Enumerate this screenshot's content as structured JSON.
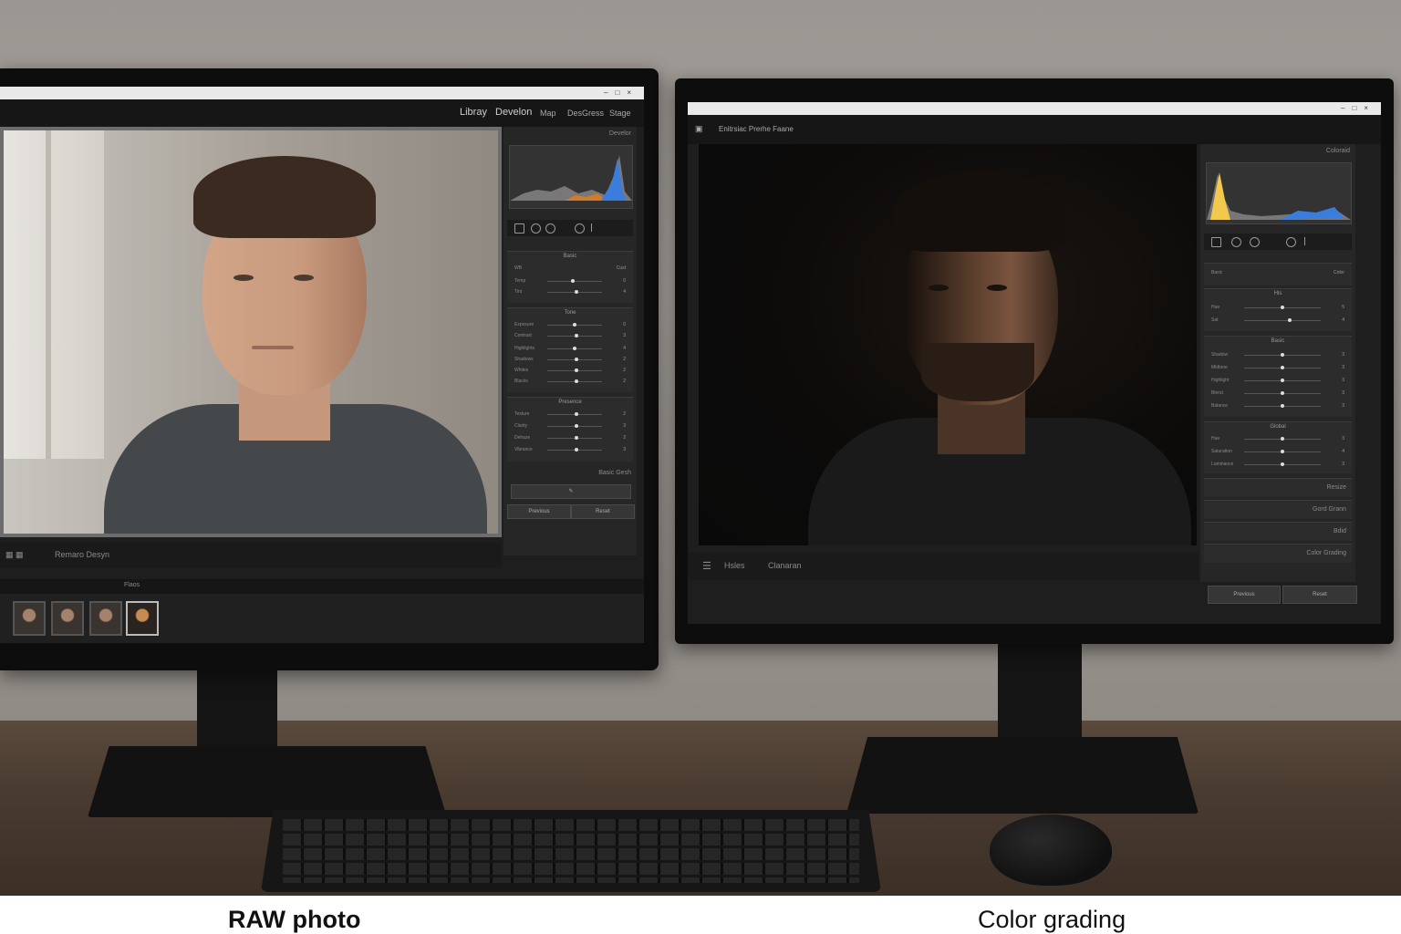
{
  "captions": {
    "left": "RAW photo",
    "right": "Color grading"
  },
  "left_monitor": {
    "title": "",
    "menu": [
      "Libray",
      "Develon",
      "Map",
      "DesGress",
      "Stage"
    ],
    "panel_header": "Develor",
    "histogram_caption": "",
    "sections": [
      {
        "title": "Basic",
        "rows": [
          {
            "label": "WB",
            "value": "Cust"
          },
          {
            "label": "Temp",
            "value": "0"
          },
          {
            "label": "Tint",
            "value": "4"
          }
        ]
      },
      {
        "title": "Tone",
        "rows": [
          {
            "label": "Exposure",
            "value": "0"
          },
          {
            "label": "Contrast",
            "value": "3"
          },
          {
            "label": "Highlights",
            "value": "4"
          },
          {
            "label": "Shadows",
            "value": "2"
          },
          {
            "label": "Whites",
            "value": "2"
          },
          {
            "label": "Blacks",
            "value": "2"
          }
        ]
      },
      {
        "title": "Presence",
        "rows": [
          {
            "label": "Texture",
            "value": "2"
          },
          {
            "label": "Clarity",
            "value": "3"
          },
          {
            "label": "Dehaze",
            "value": "2"
          },
          {
            "label": "Vibrance",
            "value": "3"
          }
        ]
      }
    ],
    "panel_footer": "Basic Gesh",
    "buttons": [
      "Previous",
      "Reset"
    ],
    "bottom_label": "Remaro Desyn",
    "strip_label": "Flaos",
    "thumbnail_count": 4
  },
  "right_monitor": {
    "title": "",
    "header_label": "Enitrsiac Prerhe Faane",
    "panel_header": "Coloraid",
    "sections": [
      {
        "title": "",
        "rows": [
          {
            "label": "Basic",
            "value": "Color"
          }
        ]
      },
      {
        "title": "Hls",
        "rows": [
          {
            "label": "Hue",
            "value": "5"
          },
          {
            "label": "Sat",
            "value": "4"
          }
        ]
      },
      {
        "title": "Basic",
        "rows": [
          {
            "label": "Shadow",
            "value": "3"
          },
          {
            "label": "Midtone",
            "value": "3"
          },
          {
            "label": "Highlight",
            "value": "3"
          },
          {
            "label": "Blend",
            "value": "3"
          },
          {
            "label": "Balance",
            "value": "3"
          }
        ]
      },
      {
        "title": "Global",
        "rows": [
          {
            "label": "Hue",
            "value": "3"
          },
          {
            "label": "Saturation",
            "value": "4"
          },
          {
            "label": "Luminance",
            "value": "3"
          }
        ]
      }
    ],
    "collapsed_sections": [
      "Resize",
      "Gord Grann",
      "Bdid",
      "Color Grading"
    ],
    "bottom_tabs": [
      "Hsles",
      "Clanaran"
    ],
    "buttons": [
      "Previous",
      "Reset"
    ]
  },
  "colors": {
    "highlight": "#f2c94c",
    "accent_blue": "#3b7ddd",
    "panel": "#262626"
  }
}
